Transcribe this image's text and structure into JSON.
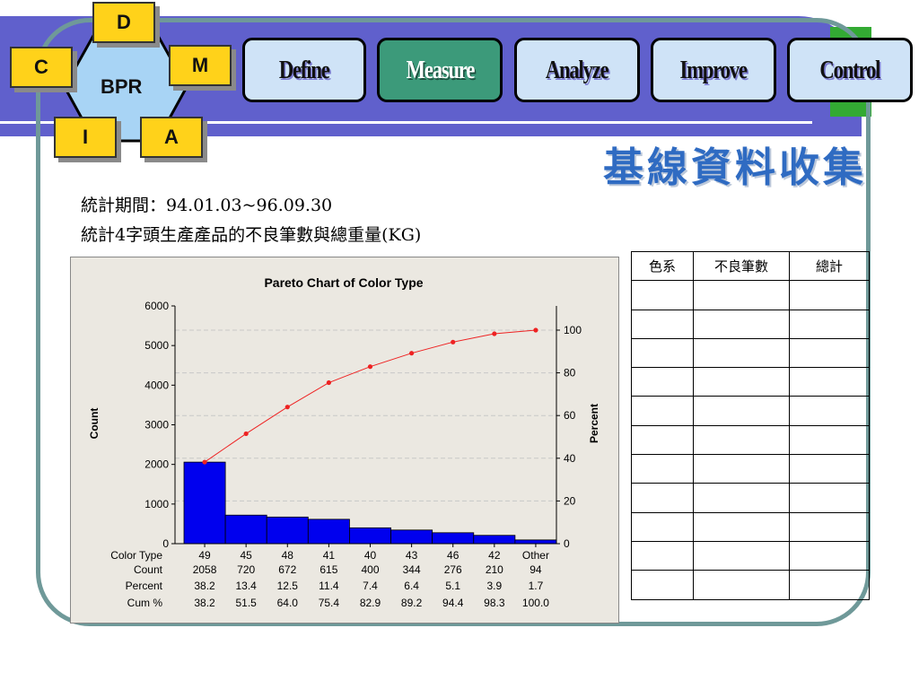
{
  "bpr": {
    "center": "BPR",
    "letters": {
      "top": "D",
      "left": "C",
      "right": "M",
      "bottom_left": "I",
      "bottom_right": "A"
    }
  },
  "nav": [
    {
      "label": "Define",
      "active": false
    },
    {
      "label": "Measure",
      "active": true
    },
    {
      "label": "Analyze",
      "active": false
    },
    {
      "label": "Improve",
      "active": false
    },
    {
      "label": "Control",
      "active": false
    }
  ],
  "title": "基線資料收集",
  "notes": [
    "統計期間：94.01.03~96.09.30",
    "統計4字頭生產產品的不良筆數與總重量(KG)"
  ],
  "colors": {
    "header": "#6060cc",
    "frame": "#6f9999",
    "accent_green": "#33aa33",
    "box": "#ffd21a",
    "bar": "#0000ee",
    "line": "#ee2222",
    "title": "#2f6bc2"
  },
  "chart_data": {
    "type": "bar",
    "title": "Pareto Chart of Color Type",
    "ylabel": "Count",
    "y2label": "Percent",
    "ylim": [
      0,
      6000
    ],
    "y2lim": [
      0,
      100
    ],
    "yticks": [
      0,
      1000,
      2000,
      3000,
      4000,
      5000,
      6000
    ],
    "y2ticks": [
      0,
      20,
      40,
      60,
      80,
      100
    ],
    "row_labels": [
      "Color Type",
      "Count",
      "Percent",
      "Cum %"
    ],
    "categories": [
      "49",
      "45",
      "48",
      "41",
      "40",
      "43",
      "46",
      "42",
      "Other"
    ],
    "counts": [
      2058,
      720,
      672,
      615,
      400,
      344,
      276,
      210,
      94
    ],
    "percent": [
      "38.2",
      "13.4",
      "12.5",
      "11.4",
      "7.4",
      "6.4",
      "5.1",
      "3.9",
      "1.7"
    ],
    "cum_percent": [
      "38.2",
      "51.5",
      "64.0",
      "75.4",
      "82.9",
      "89.2",
      "94.4",
      "98.3",
      "100.0"
    ],
    "grid": "dashed horizontal at right-axis ticks"
  },
  "table": {
    "headers": [
      "色系",
      "不良筆數",
      "總計"
    ],
    "rows": [
      [
        "",
        "",
        ""
      ],
      [
        "",
        "",
        ""
      ],
      [
        "",
        "",
        ""
      ],
      [
        "",
        "",
        ""
      ],
      [
        "",
        "",
        ""
      ],
      [
        "",
        "",
        ""
      ],
      [
        "",
        "",
        ""
      ],
      [
        "",
        "",
        ""
      ],
      [
        "",
        "",
        ""
      ],
      [
        "",
        "",
        ""
      ],
      [
        "",
        "",
        ""
      ]
    ]
  }
}
